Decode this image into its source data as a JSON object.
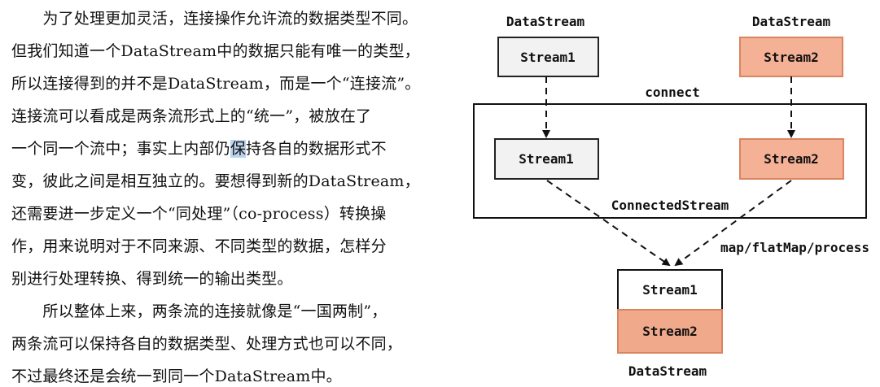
{
  "paragraphs": {
    "p1": [
      "　　为了处理更加灵活，连接操作允许流的数据类型不同。",
      "但我们知道一个DataStream中的数据只能有唯一的类型，",
      "所以连接得到的并不是DataStream，而是一个“连接流”。",
      "连接流可以看成是两条流形式上的“统一”，被放在了",
      "一个同一个流中；事实上内部仍",
      "保",
      "持各自的数据形式不",
      "变，彼此之间是相互独立的。要想得到新的DataStream，",
      "还需要进一步定义一个“同处理”（co-process）转换操",
      "作，用来说明对于不同来源、不同类型的数据，怎样分",
      "别进行处理转换、得到统一的输出类型。"
    ],
    "p2": [
      "　　所以整体上来，两条流的连接就像是“一国两制”，",
      "两条流可以保持各自的数据类型、处理方式也可以不同，",
      "不过最终还是会统一到同一个DataStream中。"
    ]
  },
  "diagram": {
    "left_source_title": "DataStream",
    "right_source_title": "DataStream",
    "left_source_box": "Stream1",
    "right_source_box": "Stream2",
    "connect_label": "connect",
    "connected_left_box": "Stream1",
    "connected_right_box": "Stream2",
    "connected_container_label": "ConnectedStream",
    "transform_label": "map/flatMap/process",
    "output_top_box": "Stream1",
    "output_bottom_box": "Stream2",
    "output_title": "DataStream"
  },
  "colors": {
    "stream1_fill": "#f2f2f2",
    "stream2_fill": "#f4b196",
    "output_stream2_fill": "#f0a98b",
    "highlight": "#bcd3ee"
  }
}
